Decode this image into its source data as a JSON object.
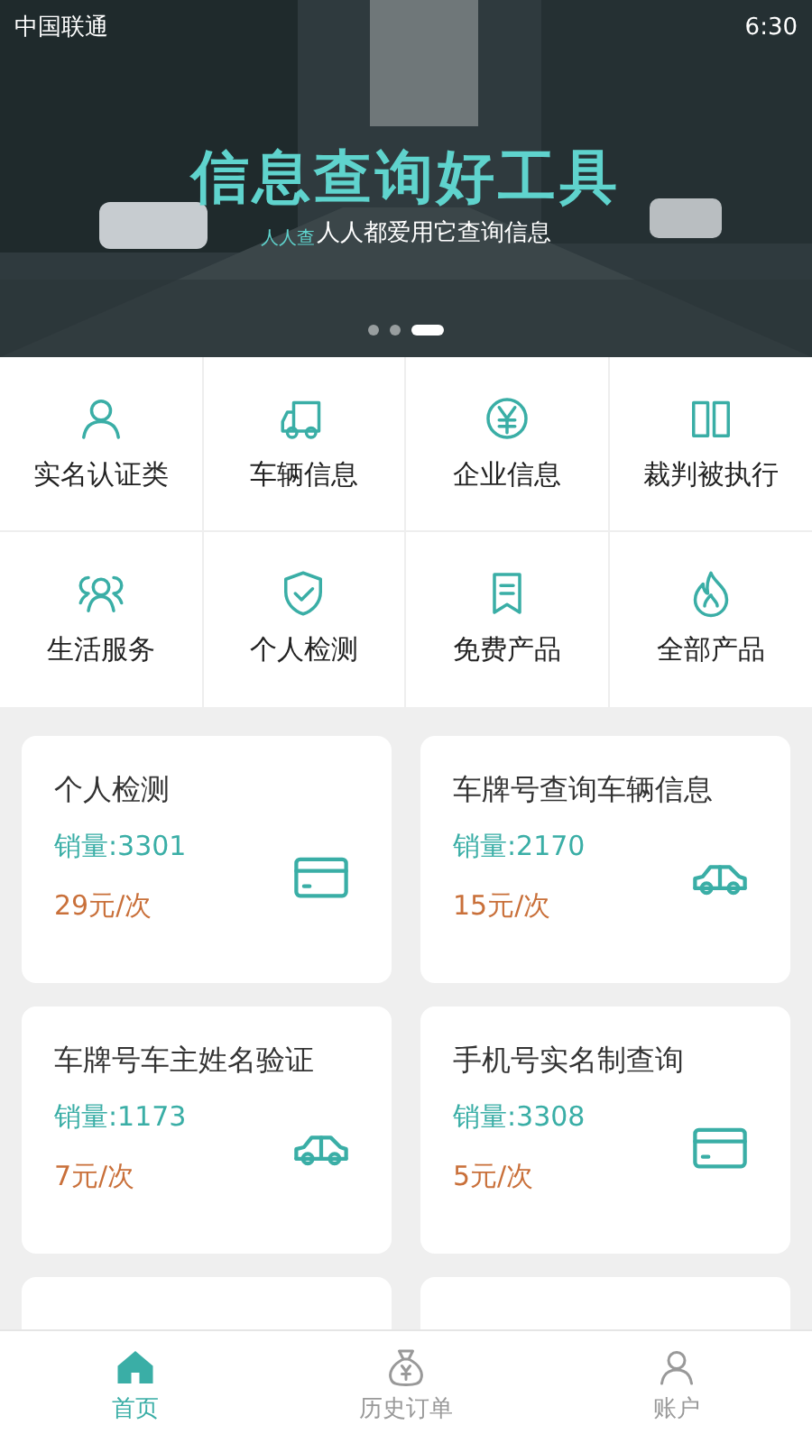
{
  "status_bar": {
    "carrier": "中国联通",
    "time": "6:30"
  },
  "banner": {
    "title": "信息查询好工具",
    "logo_text": "人人查",
    "subtitle": "人人都爱用它查询信息",
    "dots": [
      {
        "selected": false
      },
      {
        "selected": false
      },
      {
        "selected": true
      }
    ]
  },
  "categories": [
    {
      "label": "实名认证类"
    },
    {
      "label": "车辆信息"
    },
    {
      "label": "企业信息"
    },
    {
      "label": "裁判被执行"
    },
    {
      "label": "生活服务"
    },
    {
      "label": "个人检测"
    },
    {
      "label": "免费产品"
    },
    {
      "label": "全部产品"
    }
  ],
  "products": [
    {
      "title": "个人检测",
      "sales": "销量:3301",
      "price": "29元/次"
    },
    {
      "title": "车牌号查询车辆信息",
      "sales": "销量:2170",
      "price": "15元/次"
    },
    {
      "title": "车牌号车主姓名验证",
      "sales": "销量:1173",
      "price": "7元/次"
    },
    {
      "title": "手机号实名制查询",
      "sales": "销量:3308",
      "price": "5元/次"
    }
  ],
  "tab_bar": [
    {
      "label": "首页",
      "selected": true
    },
    {
      "label": "历史订单",
      "selected": false
    },
    {
      "label": "账户",
      "selected": false
    }
  ]
}
